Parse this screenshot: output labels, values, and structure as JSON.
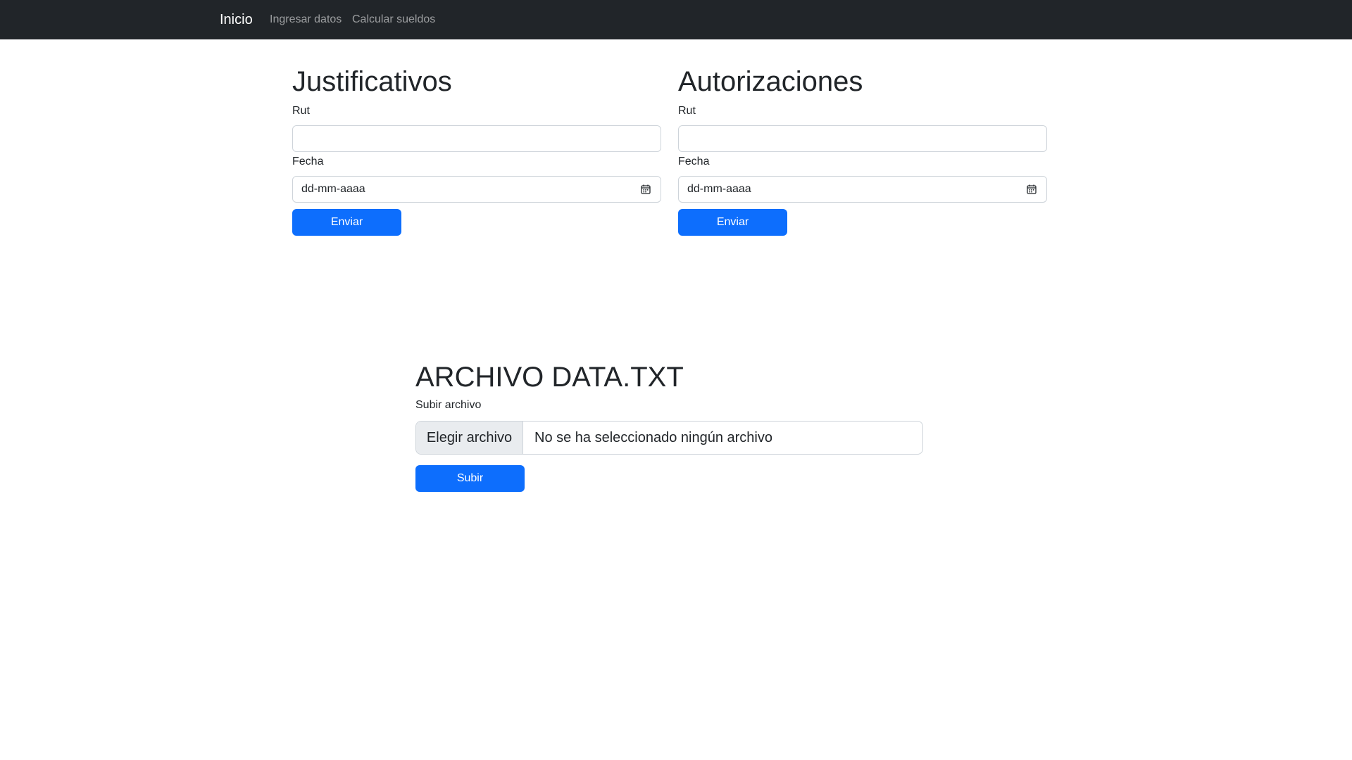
{
  "navbar": {
    "brand": "Inicio",
    "links": [
      "Ingresar datos",
      "Calcular sueldos"
    ]
  },
  "justificativos": {
    "title": "Justificativos",
    "rut_label": "Rut",
    "rut_value": "",
    "fecha_label": "Fecha",
    "fecha_placeholder": "dd-mm-aaaa",
    "submit_label": "Enviar"
  },
  "autorizaciones": {
    "title": "Autorizaciones",
    "rut_label": "Rut",
    "rut_value": "",
    "fecha_label": "Fecha",
    "fecha_placeholder": "dd-mm-aaaa",
    "submit_label": "Enviar"
  },
  "upload": {
    "title": "ARCHIVO DATA.TXT",
    "label": "Subir archivo",
    "choose_button": "Elegir archivo",
    "status": "No se ha seleccionado ningún archivo",
    "submit_label": "Subir"
  },
  "icons": {
    "calendar": "calendar-icon"
  },
  "colors": {
    "navbar_bg": "#212529",
    "primary": "#0d6efd",
    "text": "#212529"
  }
}
